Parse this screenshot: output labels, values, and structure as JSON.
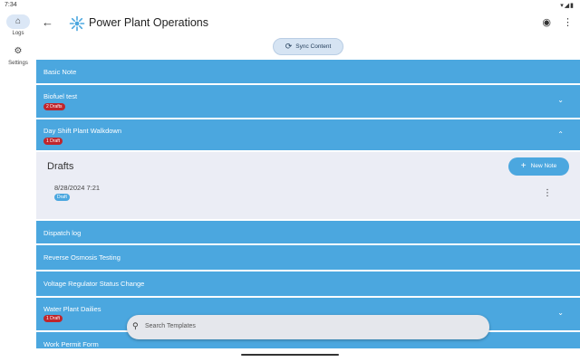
{
  "status_bar": {
    "time": "7:34",
    "icons": "▾◢▮"
  },
  "rail": {
    "items": [
      {
        "label": "Logs",
        "icon": "home-icon",
        "glyph": "⌂"
      },
      {
        "label": "Settings",
        "icon": "gear-icon",
        "glyph": "⚙"
      }
    ]
  },
  "appbar": {
    "back_glyph": "←",
    "title": "Power Plant Operations",
    "icons": [
      "connectivity-icon",
      "more-vert-icon"
    ],
    "icon_glyphs": [
      "◉",
      "⋮"
    ]
  },
  "sync": {
    "label": "Sync Content",
    "glyph": "⟳"
  },
  "templates": [
    {
      "label": "Basic Note"
    },
    {
      "label": "Biofuel test",
      "badge": "2 Drafts",
      "chevron": "⌄"
    },
    {
      "label": "Day Shift Plant Walkdown",
      "badge": "1 Draft",
      "chevron": "⌃",
      "expanded": true
    },
    {
      "label": "Dispatch log"
    },
    {
      "label": "Reverse Osmosis Testing"
    },
    {
      "label": "Voltage Regulator Status Change"
    },
    {
      "label": "Water Plant Dailies",
      "badge": "1 Draft",
      "chevron": "⌄"
    },
    {
      "label": "Work Permit Form"
    }
  ],
  "drafts": {
    "title": "Drafts",
    "new_note_label": "New Note",
    "new_note_glyph": "+",
    "items": [
      {
        "date": "8/28/2024 7:21",
        "badge": "Draft",
        "menu_glyph": "⋮"
      }
    ]
  },
  "search": {
    "placeholder": "Search Templates",
    "glyph": "⚲"
  },
  "colors": {
    "accent": "#4ba7df",
    "badge_red": "#c0252b",
    "panel_bg": "#ebedf5"
  }
}
